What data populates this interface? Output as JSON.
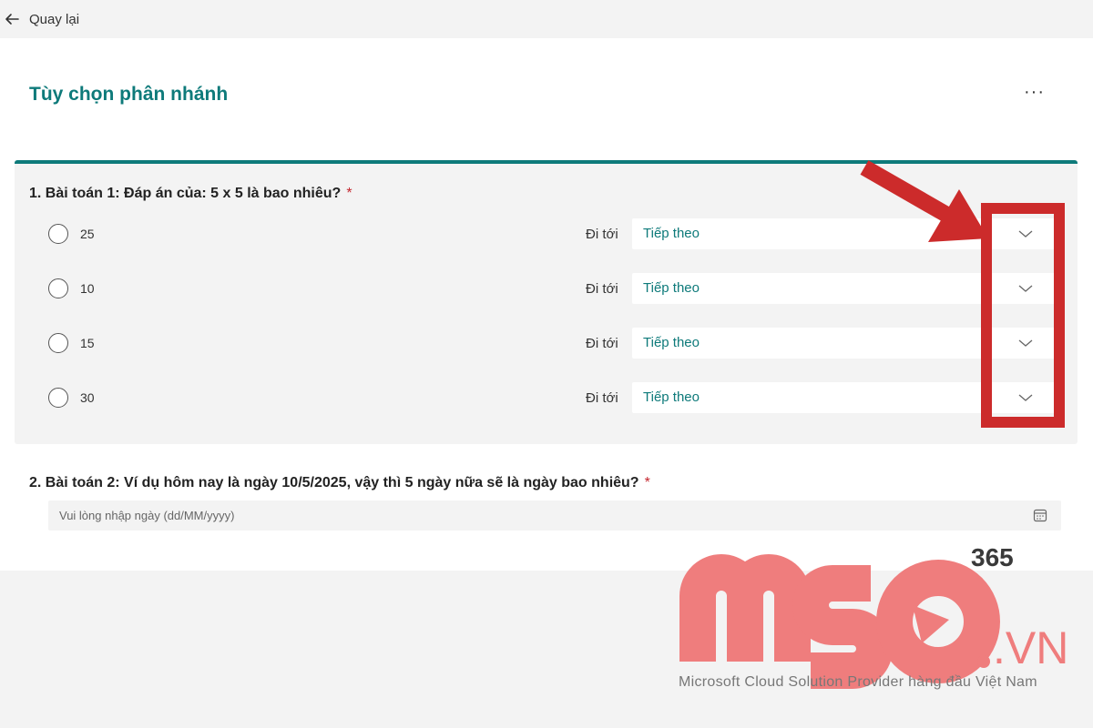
{
  "topbar": {
    "back_label": "Quay lại"
  },
  "page": {
    "title": "Tùy chọn phân nhánh",
    "more_label": "···"
  },
  "question1": {
    "title": "1. Bài toán 1: Đáp án của: 5 x 5 là bao nhiêu?",
    "required_mark": "*",
    "goto_label": "Đi tới",
    "options": [
      {
        "label": "25",
        "branch": "Tiếp theo"
      },
      {
        "label": "10",
        "branch": "Tiếp theo"
      },
      {
        "label": "15",
        "branch": "Tiếp theo"
      },
      {
        "label": "30",
        "branch": "Tiếp theo"
      }
    ]
  },
  "question2": {
    "title": "2. Bài toán 2: Ví dụ hôm nay là ngày 10/5/2025, vậy thì 5 ngày nữa sẽ là ngày bao nhiêu?",
    "required_mark": "*",
    "placeholder": "Vui lòng nhập ngày (dd/MM/yyyy)"
  },
  "watermark": {
    "brand": "MSO",
    "suffix": ".VN",
    "badge": "365",
    "tagline": "Microsoft Cloud Solution Provider hàng đầu Việt Nam"
  },
  "colors": {
    "accent": "#0e7a7a",
    "required": "#c4262e",
    "annotation": "#cc2b2b",
    "watermark": "#ef7d7d"
  },
  "icons": {
    "back": "arrow-left-icon",
    "chevron": "chevron-down-icon",
    "calendar": "calendar-icon"
  }
}
